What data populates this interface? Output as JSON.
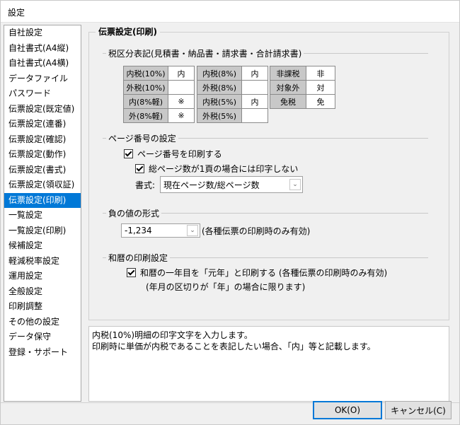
{
  "window": {
    "title": "設定"
  },
  "nav": {
    "items": [
      {
        "label": "自社設定"
      },
      {
        "label": "自社書式(A4縦)"
      },
      {
        "label": "自社書式(A4横)"
      },
      {
        "label": "データファイル"
      },
      {
        "label": "パスワード"
      },
      {
        "label": "伝票設定(既定値)"
      },
      {
        "label": "伝票設定(連番)"
      },
      {
        "label": "伝票設定(確認)"
      },
      {
        "label": "伝票設定(動作)"
      },
      {
        "label": "伝票設定(書式)"
      },
      {
        "label": "伝票設定(領収証)"
      },
      {
        "label": "伝票設定(印刷)",
        "selected": true
      },
      {
        "label": "一覧設定"
      },
      {
        "label": "一覧設定(印刷)"
      },
      {
        "label": "候補設定"
      },
      {
        "label": "軽減税率設定"
      },
      {
        "label": "運用設定"
      },
      {
        "label": "全般設定"
      },
      {
        "label": "印刷調整"
      },
      {
        "label": "その他の設定"
      },
      {
        "label": "データ保守"
      },
      {
        "label": "登録・サポート"
      }
    ]
  },
  "panel": {
    "title": "伝票設定(印刷)",
    "tax": {
      "section_label": "税区分表記(見積書・納品書・請求書・合計請求書)",
      "table1": [
        {
          "label": "内税(10%)",
          "value": "内"
        },
        {
          "label": "外税(10%)",
          "value": ""
        },
        {
          "label": "内(8%軽)",
          "value": "※"
        },
        {
          "label": "外(8%軽)",
          "value": "※"
        }
      ],
      "table2": [
        {
          "label": "内税(8%)",
          "value": "内"
        },
        {
          "label": "外税(8%)",
          "value": ""
        },
        {
          "label": "内税(5%)",
          "value": "内"
        },
        {
          "label": "外税(5%)",
          "value": ""
        }
      ],
      "table3": [
        {
          "label": "非課税",
          "value": "非"
        },
        {
          "label": "対象外",
          "value": "対"
        },
        {
          "label": "免税",
          "value": "免"
        }
      ]
    },
    "page_number": {
      "section_label": "ページ番号の設定",
      "print_label": "ページ番号を印刷する",
      "print_checked": true,
      "single_label": "総ページ数が1頁の場合には印字しない",
      "single_checked": true,
      "format_label": "書式:",
      "format_value": "現在ページ数/総ページ数"
    },
    "negative": {
      "section_label": "負の値の形式",
      "value": "-1,234",
      "note": "(各種伝票の印刷時のみ有効)"
    },
    "era": {
      "section_label": "和暦の印刷設定",
      "label": "和暦の一年目を「元年」と印刷する (各種伝票の印刷時のみ有効)",
      "checked": true,
      "note": "(年月の区切りが「年」の場合に限ります)"
    }
  },
  "description": {
    "line1": "内税(10%)明細の印字文字を入力します。",
    "line2": "印刷時に単価が内税であることを表記したい場合、「内」等と記載します。"
  },
  "buttons": {
    "ok": "OK(O)",
    "cancel": "キャンセル(C)"
  }
}
